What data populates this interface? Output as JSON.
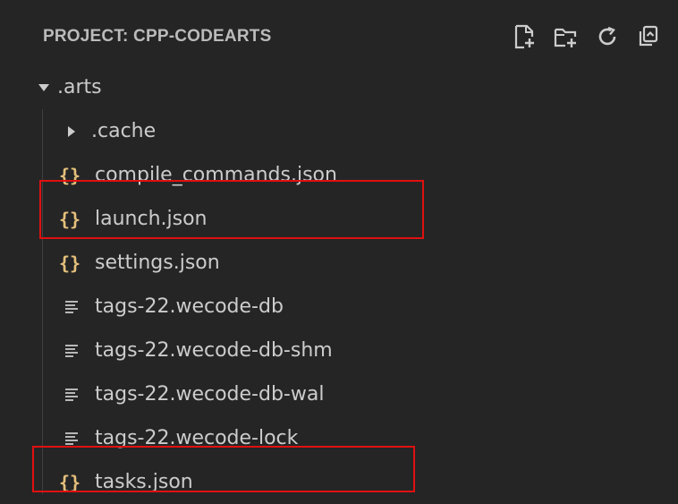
{
  "explorer": {
    "title": "PROJECT: CPP-CODEARTS",
    "toolbar": [
      {
        "name": "new-file-icon"
      },
      {
        "name": "new-folder-icon"
      },
      {
        "name": "refresh-icon"
      },
      {
        "name": "collapse-all-icon"
      }
    ]
  },
  "tree": {
    "root": {
      "label": ".arts",
      "expanded": true
    },
    "items": [
      {
        "label": ".cache",
        "type": "folder"
      },
      {
        "label": "compile_commands.json",
        "type": "json"
      },
      {
        "label": "launch.json",
        "type": "json",
        "highlighted": true
      },
      {
        "label": "settings.json",
        "type": "json"
      },
      {
        "label": "tags-22.wecode-db",
        "type": "text"
      },
      {
        "label": "tags-22.wecode-db-shm",
        "type": "text"
      },
      {
        "label": "tags-22.wecode-db-wal",
        "type": "text"
      },
      {
        "label": "tags-22.wecode-lock",
        "type": "text"
      },
      {
        "label": "tasks.json",
        "type": "json",
        "highlighted": true
      }
    ]
  },
  "colors": {
    "background": "#252526",
    "text": "#cccccc",
    "json_icon": "#e5c07b",
    "highlight_border": "#e01010"
  }
}
